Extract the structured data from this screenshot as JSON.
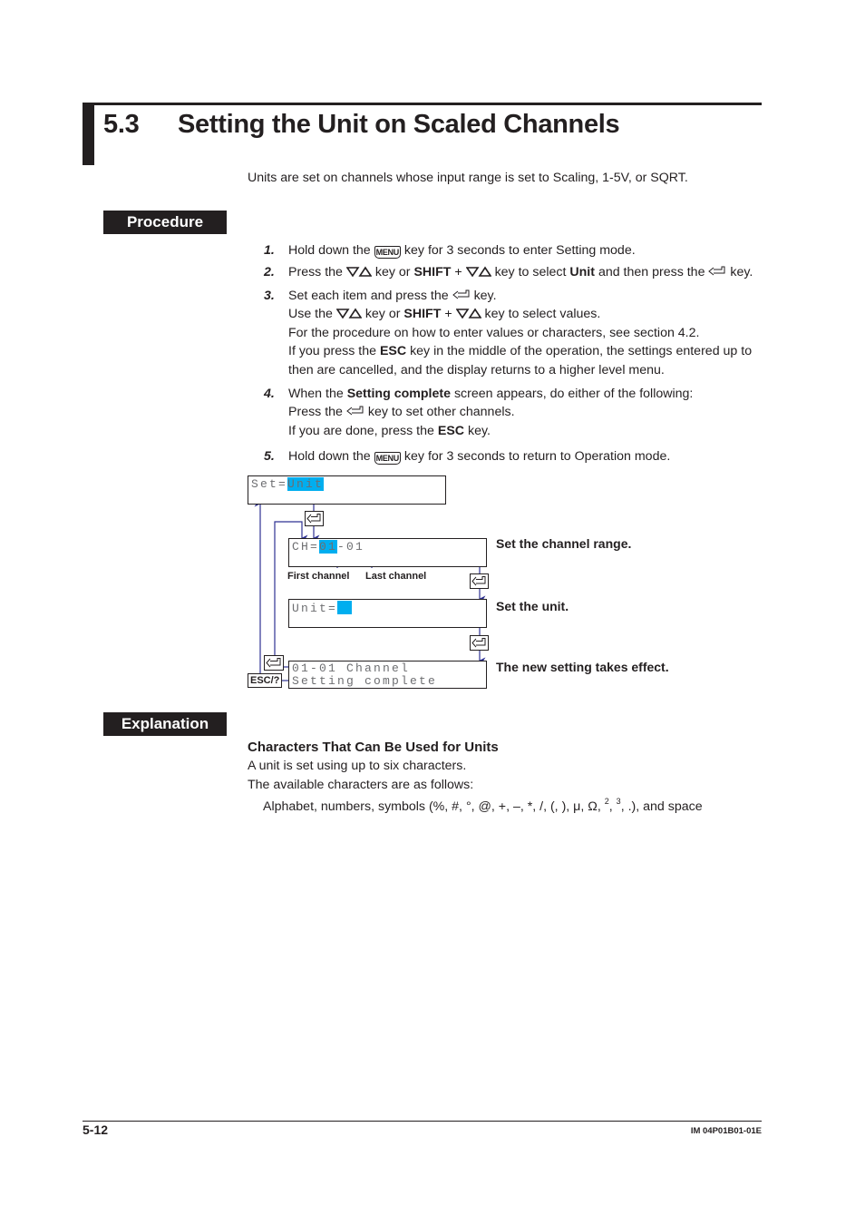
{
  "header": {
    "section_number": "5.3",
    "title": "Setting the Unit on Scaled Channels"
  },
  "intro": "Units are set on channels whose input range is set to Scaling, 1-5V, or SQRT.",
  "procedure": {
    "tag": "Procedure",
    "keys": {
      "menu": "MENU",
      "shift": "SHIFT",
      "esc": "ESC",
      "up_down_icon": "down-up-triangle-keys",
      "enter_icon": "enter-key"
    },
    "steps": [
      {
        "num": "1.",
        "lines": [
          {
            "before": "Hold down the",
            "after": "key for 3 seconds to enter Setting mode."
          }
        ]
      },
      {
        "num": "2.",
        "lines": [
          {
            "a": "Press the",
            "b": "key or",
            "shift": "SHIFT",
            "plus": "+",
            "c": "key to select",
            "unit": "Unit",
            "d": "and then press the",
            "e": "key."
          }
        ]
      },
      {
        "num": "3.",
        "lines": [
          {
            "a": "Set each item and press the",
            "b": "key."
          },
          {
            "a": "Use the",
            "b": "key or",
            "shift": "SHIFT",
            "plus": "+",
            "c": "key to select values."
          },
          {
            "text": "For the procedure on how to enter values or characters, see section 4.2."
          },
          {
            "a": "If you press the",
            "esc": "ESC",
            "b": "key in the middle of the operation, the settings entered up to"
          },
          {
            "text": "then are cancelled, and the display returns to a higher level menu."
          }
        ]
      },
      {
        "num": "4.",
        "lines": [
          {
            "a": "When the",
            "bold": "Setting complete",
            "b": "screen appears, do either of the following:"
          },
          {
            "a": "Press the",
            "b": "key to set other channels."
          },
          {
            "a": "If you are done, press the",
            "esc": "ESC",
            "b": "key."
          }
        ]
      },
      {
        "num": "5.",
        "lines": [
          {
            "before": "Hold down the",
            "after": "key for 3 seconds to return to Operation mode."
          }
        ]
      }
    ]
  },
  "diagram": {
    "screens": [
      {
        "prefix": "Set=",
        "highlight": "Unit",
        "suffix": "",
        "line2": ""
      },
      {
        "prefix": "CH=",
        "highlight": "01",
        "suffix": "-01",
        "line2": ""
      },
      {
        "prefix": "Unit=",
        "highlight": " ",
        "suffix": "",
        "line2": ""
      },
      {
        "line1": "01-01 Channel",
        "line2": "Setting complete"
      }
    ],
    "labels": {
      "channel_range": "Set the channel range.",
      "set_unit": "Set the unit.",
      "takes_effect": "The new setting takes effect.",
      "first_channel": "First channel",
      "last_channel": "Last channel",
      "esc_key": "ESC/?"
    },
    "colors": {
      "highlight": "#00aeef",
      "flow_line": "#2e3192",
      "lcd_text": "#6d6e71"
    }
  },
  "explanation": {
    "tag": "Explanation",
    "heading": "Characters That Can Be Used for Units",
    "line1": "A unit is set using up to six characters.",
    "line2": "The available characters are as follows:",
    "line3_before": "Alphabet, numbers, symbols (%, #, °, @, +, –, *, /, (, ), μ, Ω,",
    "sup2": "2",
    "sep": ",",
    "sup3": "3",
    "line3_after": ", .), and space"
  },
  "footer": {
    "page_number": "5-12",
    "document_id": "IM 04P01B01-01E"
  }
}
